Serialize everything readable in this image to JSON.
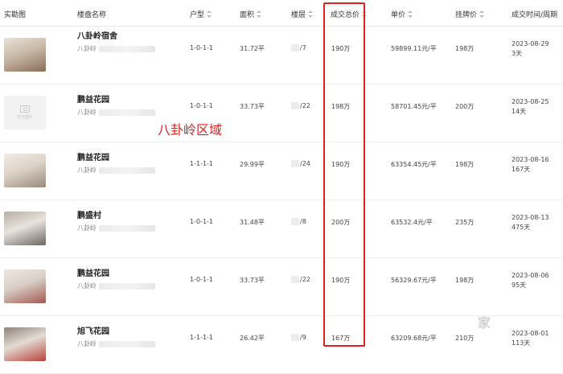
{
  "headers": {
    "photo": "实勘图",
    "name": "楼盘名称",
    "layout": "户型",
    "area": "面积",
    "floor": "楼层",
    "total": "成交总价",
    "unit": "单价",
    "list": "挂牌价",
    "date": "成交时间/周期"
  },
  "annotation": "八卦岭区域",
  "watermark": "家",
  "rows": [
    {
      "name": "八卦岭宿舍",
      "district": "八卦岭",
      "layout": "1-0-1-1",
      "area": "31.72平",
      "floor": "/7",
      "total": "190万",
      "unit": "59899.11元/平",
      "list": "198万",
      "date": "2023-08-29",
      "cycle": "3天"
    },
    {
      "name": "鹏益花园",
      "district": "八卦岭",
      "layout": "1-0-1-1",
      "area": "33.73平",
      "floor": "/22",
      "total": "198万",
      "unit": "58701.45元/平",
      "list": "200万",
      "date": "2023-08-25",
      "cycle": "14天"
    },
    {
      "name": "鹏益花园",
      "district": "八卦岭",
      "layout": "1-1-1-1",
      "area": "29.99平",
      "floor": "/24",
      "total": "190万",
      "unit": "63354.45元/平",
      "list": "198万",
      "date": "2023-08-16",
      "cycle": "167天"
    },
    {
      "name": "鹏盛村",
      "district": "八卦岭",
      "layout": "1-0-1-1",
      "area": "31.48平",
      "floor": "/8",
      "total": "200万",
      "unit": "63532.4元/平",
      "list": "235万",
      "date": "2023-08-13",
      "cycle": "475天"
    },
    {
      "name": "鹏益花园",
      "district": "八卦岭",
      "layout": "1-0-1-1",
      "area": "33.73平",
      "floor": "/22",
      "total": "190万",
      "unit": "56329.67元/平",
      "list": "198万",
      "date": "2023-08-06",
      "cycle": "95天"
    },
    {
      "name": "旭飞花园",
      "district": "八卦岭",
      "layout": "1-1-1-1",
      "area": "26.42平",
      "floor": "/9",
      "total": "167万",
      "unit": "63209.68元/平",
      "list": "210万",
      "date": "2023-08-01",
      "cycle": "113天"
    }
  ]
}
